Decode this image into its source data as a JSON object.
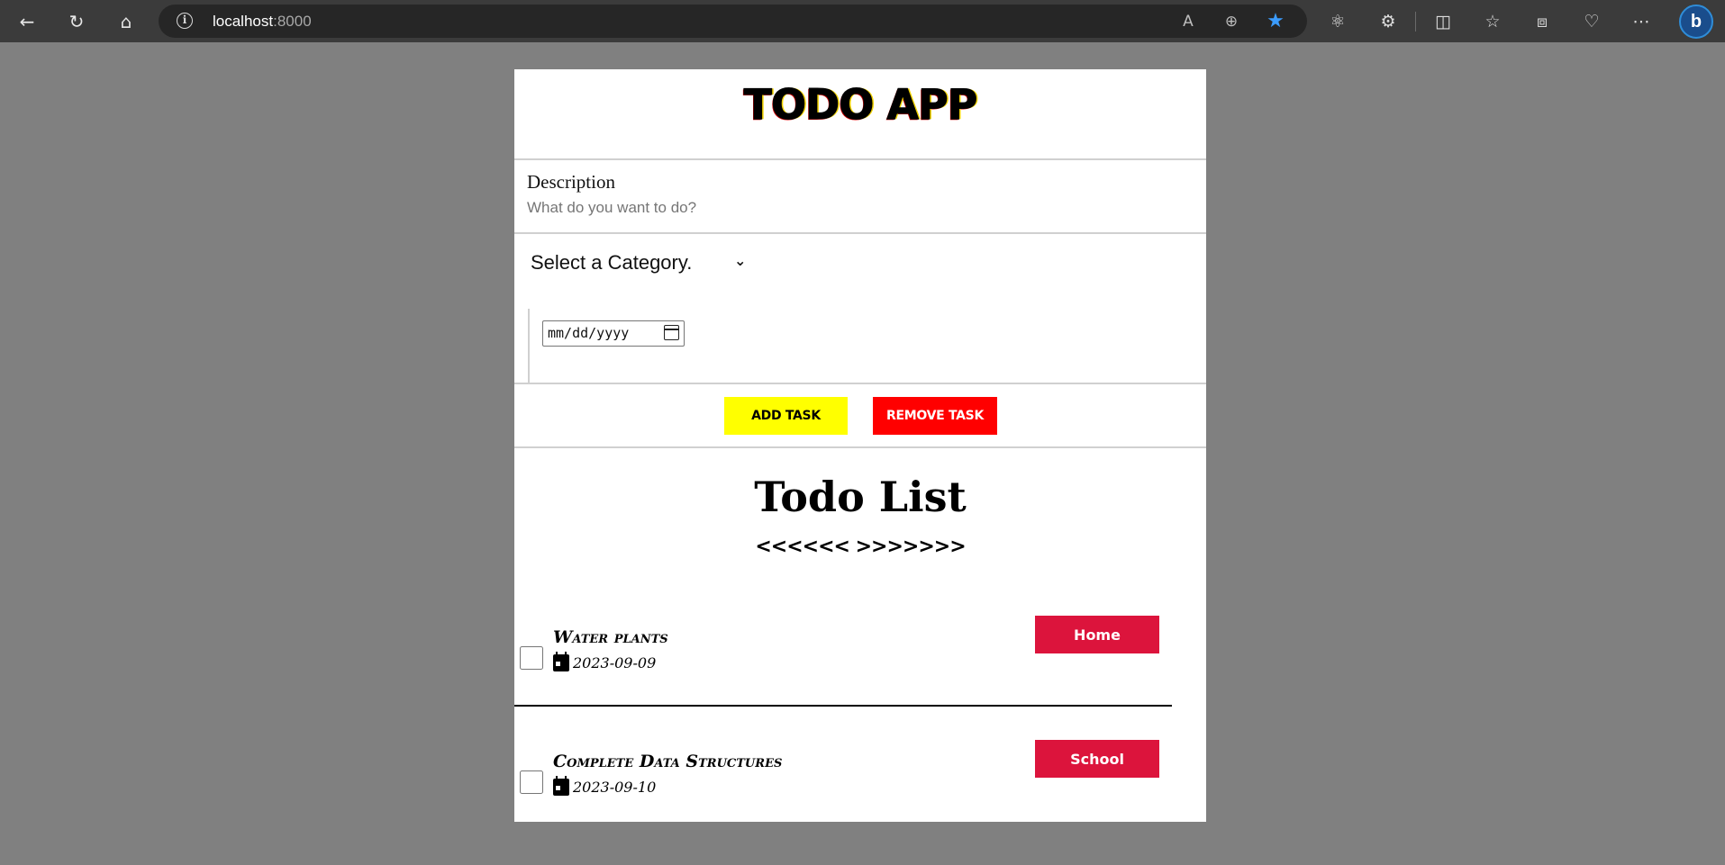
{
  "browser": {
    "url_host": "localhost",
    "url_port": ":8000"
  },
  "app": {
    "title": "TODO APP",
    "description_label": "Description",
    "description_placeholder": "What do you want to do?",
    "category_select": "Select a Category.",
    "date_placeholder": "mm/dd/yyyy",
    "add_button": "Add Task",
    "remove_button": "Remove Task",
    "list_title": "Todo List",
    "list_decoration": "<<<<<<  >>>>>>>"
  },
  "tasks": [
    {
      "name": "Water plants",
      "date": "2023-09-09",
      "category": "Home",
      "checked": false
    },
    {
      "name": "Complete Data Structures",
      "date": "2023-09-10",
      "category": "School",
      "checked": false
    }
  ],
  "colors": {
    "add_button": "#ffff00",
    "remove_button": "#ff0000",
    "category_badge": "#dc143c",
    "page_background": "#808080"
  }
}
